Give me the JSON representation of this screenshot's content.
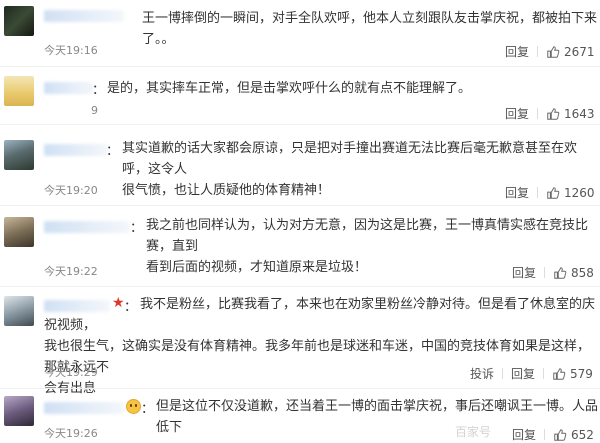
{
  "comments": [
    {
      "text": "王一博摔倒的一瞬间，对手全队欢呼，他本人立刻跟队友击掌庆祝，都被拍下来了。。",
      "time": "今天19:16",
      "reply": "回复",
      "likes": "2671"
    },
    {
      "sep": "：",
      "text": "是的，其实摔车正常，但是击掌欢呼什么的就有点不能理解了。",
      "time": "9",
      "reply": "回复",
      "likes": "1643"
    },
    {
      "sep": "：",
      "text": "其实道歉的话大家都会原谅，只是把对手撞出赛道无法比赛后毫无歉意甚至在欢呼，这令人\n很气愤，也让人质疑他的体育精神！",
      "time": "今天19:20",
      "reply": "回复",
      "likes": "1260"
    },
    {
      "sep": "：",
      "text": "我之前也同样认为，认为对方无意，因为这是比赛，王一博真情实感在竞技比赛，直到\n看到后面的视频，才知道原来是垃圾！",
      "time": "今天19:22",
      "reply": "回复",
      "likes": "858"
    },
    {
      "sep": "：",
      "text": "我不是粉丝，比赛我看了，本来也在劝家里粉丝冷静对待。但是看了休息室的庆祝视频，\n我也很生气，这确实是没有体育精神。我多年前也是球迷和车迷，中国的竞技体育如果是这样，那就永远不\n会有出息",
      "time": "今天19:29",
      "report": "投诉",
      "reply": "回复",
      "likes": "579"
    },
    {
      "sep": "：",
      "text": "但是这位不仅没道歉，还当着王一博的面击掌庆祝，事后还嘲讽王一博。人品低下",
      "time": "今天19:26",
      "reply": "回复",
      "likes": "652"
    }
  ],
  "watermark": "百家号"
}
